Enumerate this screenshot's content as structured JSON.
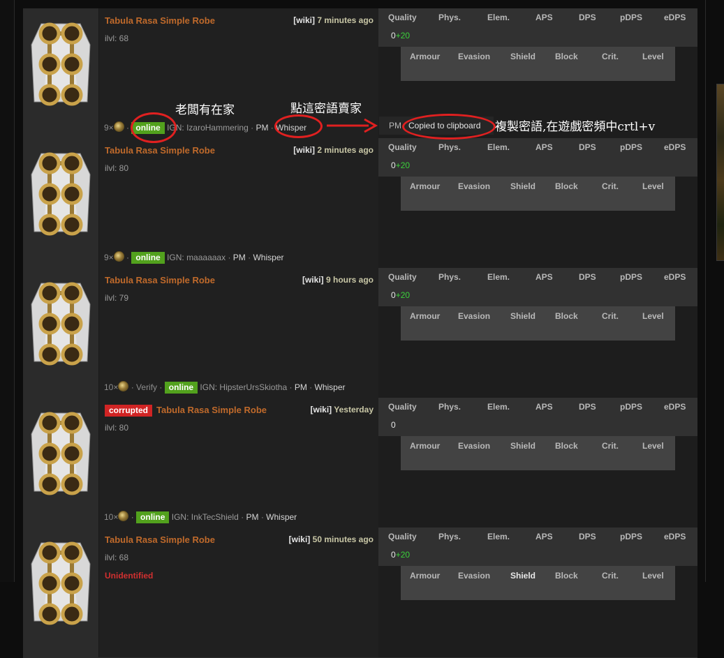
{
  "stat_headers": [
    "Quality",
    "Phys.",
    "Elem.",
    "APS",
    "DPS",
    "pDPS",
    "eDPS"
  ],
  "defense_headers": [
    "Armour",
    "Evasion",
    "Shield",
    "Block",
    "Crit.",
    "Level"
  ],
  "listings": [
    {
      "corrupted_label": "",
      "name": "Tabula Rasa Simple Robe",
      "wiki": "[wiki]",
      "time": "7 minutes ago",
      "ilvl": "ilvl: 68",
      "price": "9×",
      "sep1": "·",
      "verify": "",
      "online": "online",
      "ign": "IGN: IzaroHammering",
      "pm_sep": "·",
      "pm": "PM",
      "whisper_sep": "·",
      "whisper": "Whisper",
      "quality_base": "0",
      "quality_bonus": "+20",
      "unidentified": ""
    },
    {
      "corrupted_label": "",
      "name": "Tabula Rasa Simple Robe",
      "wiki": "[wiki]",
      "time": "2 minutes ago",
      "ilvl": "ilvl: 80",
      "price": "9×",
      "sep1": "·",
      "verify": "",
      "online": "online",
      "ign": "IGN: maaaaaax",
      "pm_sep": "·",
      "pm": "PM",
      "whisper_sep": "·",
      "whisper": "Whisper",
      "quality_base": "0",
      "quality_bonus": "+20",
      "unidentified": ""
    },
    {
      "corrupted_label": "",
      "name": "Tabula Rasa Simple Robe",
      "wiki": "[wiki]",
      "time": "9 hours ago",
      "ilvl": "ilvl: 79",
      "price": "10×",
      "sep1": "·",
      "verify": "Verify ·",
      "online": "online",
      "ign": "IGN: HipsterUrsSkiotha",
      "pm_sep": "·",
      "pm": "PM",
      "whisper_sep": "·",
      "whisper": "Whisper",
      "quality_base": "0",
      "quality_bonus": "+20",
      "unidentified": ""
    },
    {
      "corrupted_label": "corrupted",
      "name": "Tabula Rasa Simple Robe",
      "wiki": "[wiki]",
      "time": "Yesterday",
      "ilvl": "ilvl: 80",
      "price": "10×",
      "sep1": "·",
      "verify": "",
      "online": "online",
      "ign": "IGN: InkTecShield",
      "pm_sep": "·",
      "pm": "PM",
      "whisper_sep": "·",
      "whisper": "Whisper",
      "quality_base": "0",
      "quality_bonus": "",
      "unidentified": ""
    },
    {
      "corrupted_label": "",
      "name": "Tabula Rasa Simple Robe",
      "wiki": "[wiki]",
      "time": "50 minutes ago",
      "ilvl": "ilvl: 68",
      "price": "",
      "sep1": "",
      "verify": "",
      "online": "",
      "ign": "",
      "pm_sep": "",
      "pm": "",
      "whisper_sep": "",
      "whisper": "",
      "quality_base": "0",
      "quality_bonus": "+20",
      "unidentified": "Unidentified"
    }
  ],
  "copy_tooltip": {
    "pm": "PM",
    "text": "Copied to clipboard"
  },
  "annotations": {
    "online_note": "老闆有在家",
    "whisper_note": "點這密語賣家",
    "copy_note": "複製密語,在遊戲密頻中crtl+v"
  },
  "colors": {
    "item_name": "#c06a2b",
    "online_badge": "#52a11d",
    "corrupted_badge": "#d02424",
    "annotation_ring": "#e02020",
    "quality_bonus": "#3ad13a"
  },
  "icons": {
    "item": "tabula-rasa-robe-icon",
    "currency": "chaos-orb-icon"
  }
}
